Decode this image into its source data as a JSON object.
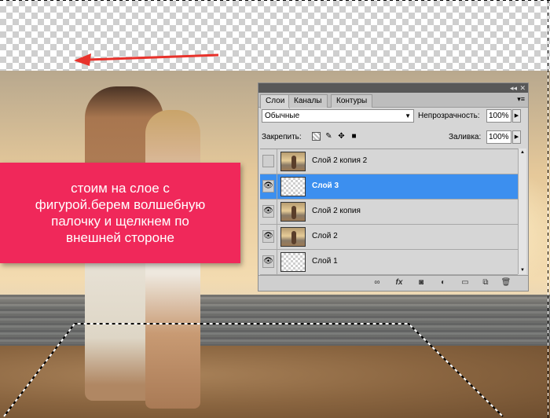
{
  "callout": {
    "text": "стоим на слое с фигурой.берем волшебную палочку и щелкнем по внешней стороне"
  },
  "panel": {
    "tabs": [
      "Слои",
      "Каналы",
      "Контуры"
    ],
    "blend_mode": "Обычные",
    "opacity_label": "Непрозрачность:",
    "opacity_value": "100%",
    "lock_label": "Закрепить:",
    "fill_label": "Заливка:",
    "fill_value": "100%",
    "layers": [
      {
        "name": "Слой 2 копия 2",
        "visible": false,
        "selected": false,
        "thumb": "image"
      },
      {
        "name": "Слой 3",
        "visible": true,
        "selected": true,
        "thumb": "transparent"
      },
      {
        "name": "Слой 2 копия",
        "visible": true,
        "selected": false,
        "thumb": "image"
      },
      {
        "name": "Слой 2",
        "visible": true,
        "selected": false,
        "thumb": "image"
      },
      {
        "name": "Слой 1",
        "visible": true,
        "selected": false,
        "thumb": "transparent"
      }
    ],
    "footer_icons": [
      "link-layers-icon",
      "fx-icon",
      "layer-mask-icon",
      "adjustment-layer-icon",
      "new-group-icon",
      "new-layer-icon",
      "trash-icon"
    ]
  },
  "colors": {
    "callout_bg": "#f0285a",
    "selected_layer": "#3c8fef",
    "arrow": "#e8322b"
  }
}
